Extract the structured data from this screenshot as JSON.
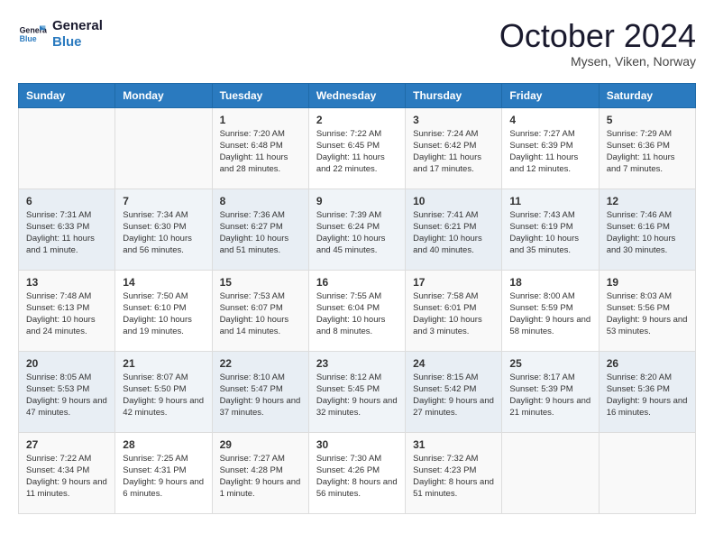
{
  "header": {
    "logo_general": "General",
    "logo_blue": "Blue",
    "month": "October 2024",
    "location": "Mysen, Viken, Norway"
  },
  "weekdays": [
    "Sunday",
    "Monday",
    "Tuesday",
    "Wednesday",
    "Thursday",
    "Friday",
    "Saturday"
  ],
  "weeks": [
    [
      {
        "day": "",
        "info": ""
      },
      {
        "day": "",
        "info": ""
      },
      {
        "day": "1",
        "info": "Sunrise: 7:20 AM\nSunset: 6:48 PM\nDaylight: 11 hours and 28 minutes."
      },
      {
        "day": "2",
        "info": "Sunrise: 7:22 AM\nSunset: 6:45 PM\nDaylight: 11 hours and 22 minutes."
      },
      {
        "day": "3",
        "info": "Sunrise: 7:24 AM\nSunset: 6:42 PM\nDaylight: 11 hours and 17 minutes."
      },
      {
        "day": "4",
        "info": "Sunrise: 7:27 AM\nSunset: 6:39 PM\nDaylight: 11 hours and 12 minutes."
      },
      {
        "day": "5",
        "info": "Sunrise: 7:29 AM\nSunset: 6:36 PM\nDaylight: 11 hours and 7 minutes."
      }
    ],
    [
      {
        "day": "6",
        "info": "Sunrise: 7:31 AM\nSunset: 6:33 PM\nDaylight: 11 hours and 1 minute."
      },
      {
        "day": "7",
        "info": "Sunrise: 7:34 AM\nSunset: 6:30 PM\nDaylight: 10 hours and 56 minutes."
      },
      {
        "day": "8",
        "info": "Sunrise: 7:36 AM\nSunset: 6:27 PM\nDaylight: 10 hours and 51 minutes."
      },
      {
        "day": "9",
        "info": "Sunrise: 7:39 AM\nSunset: 6:24 PM\nDaylight: 10 hours and 45 minutes."
      },
      {
        "day": "10",
        "info": "Sunrise: 7:41 AM\nSunset: 6:21 PM\nDaylight: 10 hours and 40 minutes."
      },
      {
        "day": "11",
        "info": "Sunrise: 7:43 AM\nSunset: 6:19 PM\nDaylight: 10 hours and 35 minutes."
      },
      {
        "day": "12",
        "info": "Sunrise: 7:46 AM\nSunset: 6:16 PM\nDaylight: 10 hours and 30 minutes."
      }
    ],
    [
      {
        "day": "13",
        "info": "Sunrise: 7:48 AM\nSunset: 6:13 PM\nDaylight: 10 hours and 24 minutes."
      },
      {
        "day": "14",
        "info": "Sunrise: 7:50 AM\nSunset: 6:10 PM\nDaylight: 10 hours and 19 minutes."
      },
      {
        "day": "15",
        "info": "Sunrise: 7:53 AM\nSunset: 6:07 PM\nDaylight: 10 hours and 14 minutes."
      },
      {
        "day": "16",
        "info": "Sunrise: 7:55 AM\nSunset: 6:04 PM\nDaylight: 10 hours and 8 minutes."
      },
      {
        "day": "17",
        "info": "Sunrise: 7:58 AM\nSunset: 6:01 PM\nDaylight: 10 hours and 3 minutes."
      },
      {
        "day": "18",
        "info": "Sunrise: 8:00 AM\nSunset: 5:59 PM\nDaylight: 9 hours and 58 minutes."
      },
      {
        "day": "19",
        "info": "Sunrise: 8:03 AM\nSunset: 5:56 PM\nDaylight: 9 hours and 53 minutes."
      }
    ],
    [
      {
        "day": "20",
        "info": "Sunrise: 8:05 AM\nSunset: 5:53 PM\nDaylight: 9 hours and 47 minutes."
      },
      {
        "day": "21",
        "info": "Sunrise: 8:07 AM\nSunset: 5:50 PM\nDaylight: 9 hours and 42 minutes."
      },
      {
        "day": "22",
        "info": "Sunrise: 8:10 AM\nSunset: 5:47 PM\nDaylight: 9 hours and 37 minutes."
      },
      {
        "day": "23",
        "info": "Sunrise: 8:12 AM\nSunset: 5:45 PM\nDaylight: 9 hours and 32 minutes."
      },
      {
        "day": "24",
        "info": "Sunrise: 8:15 AM\nSunset: 5:42 PM\nDaylight: 9 hours and 27 minutes."
      },
      {
        "day": "25",
        "info": "Sunrise: 8:17 AM\nSunset: 5:39 PM\nDaylight: 9 hours and 21 minutes."
      },
      {
        "day": "26",
        "info": "Sunrise: 8:20 AM\nSunset: 5:36 PM\nDaylight: 9 hours and 16 minutes."
      }
    ],
    [
      {
        "day": "27",
        "info": "Sunrise: 7:22 AM\nSunset: 4:34 PM\nDaylight: 9 hours and 11 minutes."
      },
      {
        "day": "28",
        "info": "Sunrise: 7:25 AM\nSunset: 4:31 PM\nDaylight: 9 hours and 6 minutes."
      },
      {
        "day": "29",
        "info": "Sunrise: 7:27 AM\nSunset: 4:28 PM\nDaylight: 9 hours and 1 minute."
      },
      {
        "day": "30",
        "info": "Sunrise: 7:30 AM\nSunset: 4:26 PM\nDaylight: 8 hours and 56 minutes."
      },
      {
        "day": "31",
        "info": "Sunrise: 7:32 AM\nSunset: 4:23 PM\nDaylight: 8 hours and 51 minutes."
      },
      {
        "day": "",
        "info": ""
      },
      {
        "day": "",
        "info": ""
      }
    ]
  ]
}
